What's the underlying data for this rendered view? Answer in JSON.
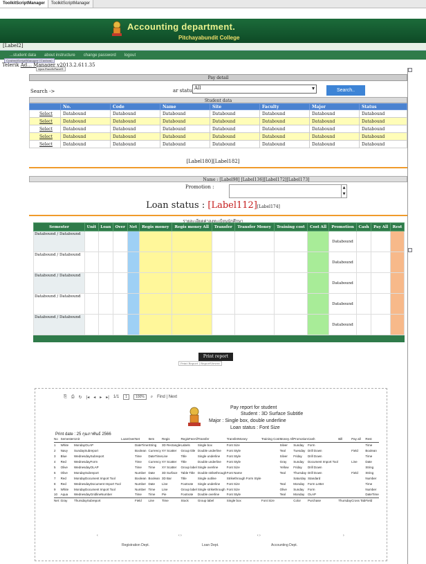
{
  "tabs": [
    "ToolkitScriptManager",
    "ToolkitScriptManager"
  ],
  "banner": {
    "department": "Accounting department.",
    "college": "Pitchayabundit College"
  },
  "label2": "[Label2]",
  "menu": [
    "...student data",
    "about instructure",
    "change password",
    "logout"
  ],
  "telerik": {
    "prefix": "Telerik",
    "link": "Ad... Manager",
    "version": "v2013.2.611.35"
  },
  "cs_tags": {
    "top": "ContentScriptManager (Custom)",
    "bottom": "Ajax.PanelsPanel1"
  },
  "pay_detail": {
    "header": "Pay detail",
    "search_label": "Search ->",
    "status_label": "ar status :",
    "status_value": "All",
    "search_button": "Search.."
  },
  "student": {
    "title": "Student data",
    "columns": [
      "",
      "No.",
      "Code",
      "Name",
      "Site",
      "Faculty",
      "Major",
      "Status"
    ],
    "rows": [
      [
        "Select",
        "Databound",
        "Databound",
        "Databound",
        "Databound",
        "Databound",
        "Databound",
        "Databound"
      ],
      [
        "Select",
        "Databound",
        "Databound",
        "Databound",
        "Databound",
        "Databound",
        "Databound",
        "Databound"
      ],
      [
        "Select",
        "Databound",
        "Databound",
        "Databound",
        "Databound",
        "Databound",
        "Databound",
        "Databound"
      ],
      [
        "Select",
        "Databound",
        "Databound",
        "Databound",
        "Databound",
        "Databound",
        "Databound",
        "Databound"
      ],
      [
        "Select",
        "Databound",
        "Databound",
        "Databound",
        "Databound",
        "Databound",
        "Databound",
        "Databound"
      ]
    ],
    "labels_under": "[Label180][Label182]"
  },
  "name_row": "Name : [Label98]  [Label136][Label172][Label173]",
  "promotion_label": "Promotion :",
  "loan_status": {
    "prefix": "Loan status : ",
    "value": "[Label112]",
    "extra": "[Label174]"
  },
  "thai_title": "รายละเอียดค่าลงทะเบียนนักศึกษา",
  "pay_table": {
    "columns": [
      "Semester",
      "Unit",
      "Loan",
      "Over",
      "Net",
      "Regis money",
      "Regis money All",
      "Transfer",
      "Transfer Money",
      "Training cost",
      "Cost All",
      "Promotion",
      "Cash",
      "Pay All",
      "Rest"
    ],
    "rows": [
      {
        "semester": "Databound / Databound",
        "promotion": "Databound"
      },
      {
        "semester": "Databound / Databound",
        "promotion": "Databound"
      },
      {
        "semester": "Databound / Databound",
        "promotion": "Databound"
      },
      {
        "semester": "Databound / Databound",
        "promotion": "Databound"
      },
      {
        "semester": "Databound / Databound",
        "promotion": "Databound"
      }
    ]
  },
  "print_button": "Print report",
  "print_sub": "Print Report | ReportViewer",
  "viewer": {
    "page": "1",
    "of": "1/1",
    "zoom": "100%",
    "find_label": "Find | Next"
  },
  "report": {
    "title": "Pay report for student",
    "student": "Student : 3D Surface Subtitle",
    "major": "Major : Single box, double underline",
    "loan": "Loan status : Font Size",
    "print_date": "Print date : 25 กุมภาพันธ์ 2566",
    "columns": [
      "No",
      "Semester",
      "Unit",
      "Loan",
      "Over",
      "Net",
      "Item",
      "Regis",
      "RegisFeeAll",
      "Transfer",
      "TransferMoney",
      "Training Cost",
      "Money All",
      "Promotion",
      "Cash",
      "Bill",
      "Pay all",
      "Rest"
    ],
    "rows": [
      [
        "1",
        "White",
        "MondayOLAP",
        "",
        "",
        "DateTime",
        "String",
        "3D Rectangle",
        "Labels",
        "Single box",
        "Font Size",
        "",
        "Silver",
        "Sunday",
        "Form",
        "",
        "",
        "Time"
      ],
      [
        "2",
        "Navy",
        "SundaySubreport",
        "",
        "",
        "Boolean",
        "Currency",
        "XY Scatter",
        "Group title",
        "Double underline",
        "Font Style",
        "",
        "Teal",
        "Tuesday",
        "Drill Down",
        "",
        "Field",
        "Boolean"
      ],
      [
        "3",
        "Blue",
        "WednesdaySubreport",
        "",
        "",
        "Time",
        "DateTime",
        "Line",
        "Title",
        "Single underline",
        "Font Style",
        "",
        "Silver",
        "Friday",
        "Drill Down",
        "",
        "",
        "Time"
      ],
      [
        "4",
        "Red",
        "WednesdayForm",
        "",
        "",
        "Time",
        "Currency",
        "XY Scatter",
        "Title",
        "Double underline",
        "Font Style",
        "",
        "Gray",
        "Sunday",
        "Document Import Tool",
        "",
        "Line",
        "Date"
      ],
      [
        "5",
        "Olive",
        "WednesdayOLAP",
        "",
        "",
        "Time",
        "Time",
        "XY Scatter",
        "Group label",
        "Single overline",
        "Font Size",
        "",
        "Yellow",
        "Friday",
        "Drill Down",
        "",
        "",
        "String"
      ],
      [
        "6",
        "Olive",
        "MondaySubreport",
        "",
        "",
        "Number",
        "Date",
        "3D Surface",
        "Table Title",
        "Double strikethrough",
        "Font Name",
        "",
        "Teal",
        "Thursday",
        "Drill Down",
        "",
        "Field",
        "String"
      ],
      [
        "7",
        "Red",
        "MondayDocument Import Tool",
        "",
        "",
        "Boolean",
        "Boolean",
        "3D Bar",
        "Title",
        "Single outline",
        "Strikethrough Form Style",
        "",
        "",
        "Saturday",
        "Standard",
        "",
        "",
        "Number"
      ],
      [
        "8",
        "Red",
        "WednesdayDocument Import Tool",
        "",
        "",
        "Number",
        "Date",
        "Line",
        "Footnote",
        "Single underline",
        "Font Size",
        "",
        "Teal",
        "Monday",
        "Form Letter",
        "",
        "",
        "Time"
      ],
      [
        "9",
        "White",
        "MondayDocument Import Tool",
        "",
        "",
        "Number",
        "Time",
        "Line",
        "Group label",
        "Single strikethrough",
        "Font Size",
        "",
        "Olive",
        "Sunday",
        "Form",
        "",
        "",
        "Number"
      ],
      [
        "10",
        "Aqua",
        "WednesdayGridlineNumber",
        "",
        "",
        "Time",
        "Time",
        "Pie",
        "Footnote",
        "Double overline",
        "Font Style",
        "",
        "Teal",
        "Monday",
        "OLAP",
        "",
        "",
        "DateTime"
      ]
    ],
    "net_row": [
      "Net :",
      "Gray",
      "ThursdaySubreport",
      "",
      "",
      "Field",
      "Line",
      "Time",
      "Stock",
      "Group label",
      "Single box",
      "Font Size",
      "",
      "Color",
      "Purchase",
      "Thursday",
      "Cross Tab",
      "Field"
    ],
    "footer": [
      "Registration Dept.",
      "Loan Dept.",
      "Accounting Dept."
    ]
  }
}
